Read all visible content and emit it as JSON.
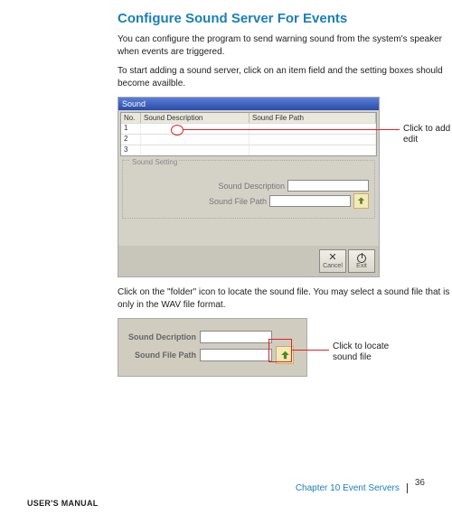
{
  "title": "Configure Sound Server For Events",
  "para1": "You can configure the program to send warning sound from the system's speaker when events are triggered.",
  "para2": "To start adding a sound server, click on an item field and the setting boxes should become availble.",
  "dialog1": {
    "title": "Sound",
    "cols": {
      "no": "No.",
      "desc": "Sound Description",
      "path": "Sound File Path"
    },
    "rows": [
      "1",
      "2",
      "3"
    ],
    "panel_title": "Sound Setting",
    "desc_label": "Sound Description",
    "path_label": "Sound File Path",
    "cancel": "Cancel",
    "exit": "Exit"
  },
  "annot1": "Click to add or edit",
  "para3": "Click on the \"folder\" icon to locate the sound file. You may select a sound file that is only in the WAV file format.",
  "dialog2": {
    "desc_label": "Sound Decription",
    "path_label": "Sound File Path"
  },
  "annot2": "Click to locate sound file",
  "chapter": "Chapter 10   Event Servers",
  "page": "36",
  "footer": "USER'S MANUAL"
}
